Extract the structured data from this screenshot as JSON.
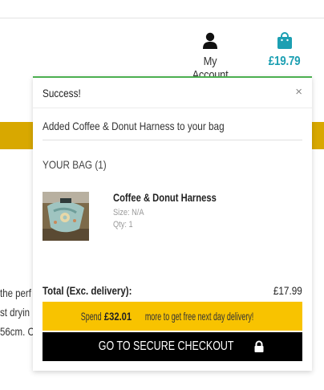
{
  "header": {
    "account_label": "My Account",
    "bag_total": "£19.79"
  },
  "background": {
    "line1": "the perf",
    "line2": "st dryin",
    "line3": "56cm. C"
  },
  "notification": {
    "title": "Success!",
    "close_label": "×",
    "added_message": "Added Coffee & Donut Harness to your bag"
  },
  "bag": {
    "heading": "YOUR BAG (1)",
    "items": [
      {
        "name": "Coffee & Donut Harness",
        "size": "Size: N/A",
        "qty": "Qty: 1"
      }
    ],
    "total_label": "Total (Exc. delivery):",
    "total_value": "£17.99"
  },
  "promo": {
    "prefix": "Spend ",
    "amount": "£32.01",
    "suffix": " more to get free next day delivery!"
  },
  "checkout": {
    "label": "GO TO SECURE CHECKOUT"
  },
  "colors": {
    "accent": "#1c9fb2",
    "success_border": "#4caf50",
    "promo_bg": "#f8c300",
    "band": "#d8a800"
  },
  "icons": {
    "account": "user-icon",
    "bag": "shopping-bag-icon",
    "close": "close-icon",
    "checkout": "lock-icon"
  }
}
